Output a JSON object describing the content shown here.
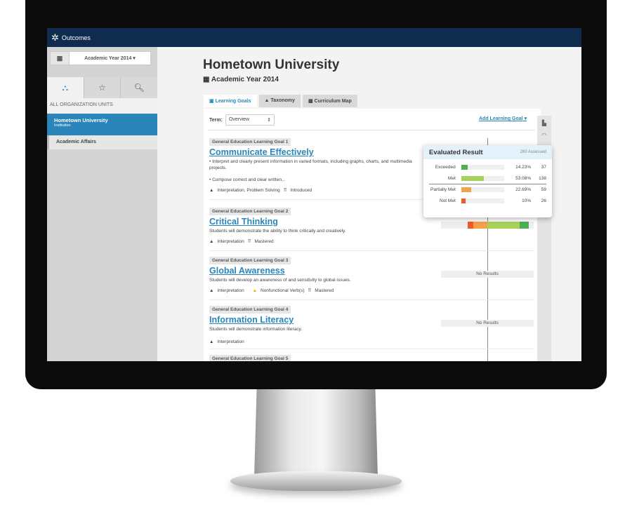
{
  "app": {
    "name": "Outcomes"
  },
  "sidebar": {
    "year": "Academic Year 2014",
    "section_label": "ALL ORGANIZATION UNITS",
    "units": [
      {
        "name": "Hometown University",
        "type": "Institution"
      },
      {
        "name": "Academic Affairs"
      }
    ]
  },
  "main": {
    "title": "Hometown University",
    "subtitle": "Academic Year 2014",
    "tabs": [
      {
        "label": "Learning Goals",
        "active": true
      },
      {
        "label": "Taxonomy"
      },
      {
        "label": "Curriculum Map"
      }
    ],
    "term_label": "Term:",
    "term_value": "Overview",
    "add_goal": "Add Learning Goal",
    "goals": [
      {
        "tag": "General Education Learning Goal 1",
        "name": "Communicate Effectively",
        "desc": [
          "• Interpret and clearly present information in varied formats, including graphs, charts, and multimedia projects.",
          "• Compose correct and clear written..."
        ],
        "taxonomy": "Interpretation, Problem Solving",
        "level": "Introduced"
      },
      {
        "tag": "General Education Learning Goal 2",
        "name": "Critical Thinking",
        "desc": [
          "Students will demonstrate the ability to think critically and creatively."
        ],
        "taxonomy": "Interpretation",
        "level": "Mastered"
      },
      {
        "tag": "General Education Learning Goal 3",
        "name": "Global Awareness",
        "desc": [
          "Students will develop an awareness of and sensitivity to global issues."
        ],
        "taxonomy": "Interpretation",
        "warning": "Nonfunctional Verb(s)",
        "level": "Mastered",
        "result": "No Results"
      },
      {
        "tag": "General Education Learning Goal 4",
        "name": "Information Literacy",
        "desc": [
          "Students will demonstrate information literacy."
        ],
        "taxonomy": "Interpretation",
        "result": "No Results"
      },
      {
        "tag": "General Education Learning Goal 5"
      }
    ]
  },
  "tooltip": {
    "title": "Evaluated Result",
    "assessed": "260 Assessed",
    "rows": [
      {
        "label": "Exceeded",
        "pct": "14.23%",
        "count": "37",
        "value": 14.23,
        "color": "#4cb050"
      },
      {
        "label": "Met",
        "pct": "53.08%",
        "count": "138",
        "value": 53.08,
        "color": "#a9d15a"
      },
      {
        "label": "Partially Met",
        "pct": "22.69%",
        "count": "59",
        "value": 22.69,
        "color": "#f5a04a"
      },
      {
        "label": "Not Met",
        "pct": "10%",
        "count": "26",
        "value": 10,
        "color": "#ef5a2a"
      }
    ]
  }
}
